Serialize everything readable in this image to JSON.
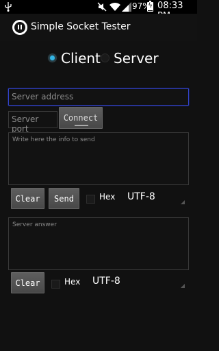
{
  "status_bar": {
    "battery": "97%",
    "time": "08:33 PM",
    "icons": [
      "usb-icon",
      "mute-icon",
      "wifi-icon",
      "signal-icon",
      "battery-icon"
    ]
  },
  "app": {
    "title": "Simple Socket Tester",
    "icon": "app-icon"
  },
  "mode": {
    "client_label": "Client",
    "server_label": "Server",
    "selected": "Client"
  },
  "connection": {
    "address_placeholder": "Server address",
    "port_placeholder": "Server port",
    "connect_label": "Connect"
  },
  "send": {
    "placeholder": "Write here the info to send",
    "clear_label": "Clear",
    "send_label": "Send",
    "hex_label": "Hex",
    "encoding": "UTF-8"
  },
  "answer": {
    "placeholder": "Server answer",
    "clear_label": "Clear",
    "hex_label": "Hex",
    "encoding": "UTF-8"
  },
  "colors": {
    "accent": "#33b5e5",
    "focus_border": "#3344cc",
    "background": "#111111"
  }
}
